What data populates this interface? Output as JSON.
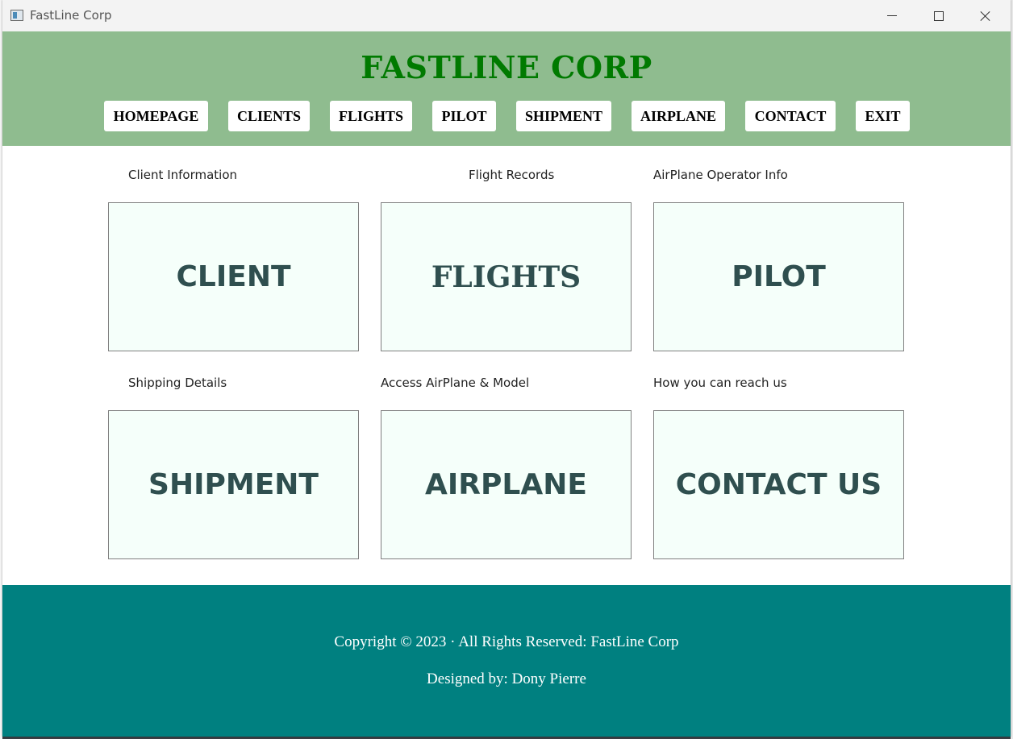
{
  "window": {
    "title": "FastLine Corp"
  },
  "header": {
    "brand": "FASTLINE CORP",
    "nav": [
      "HOMEPAGE",
      "CLIENTS",
      "FLIGHTS",
      "PILOT",
      "SHIPMENT",
      "AIRPLANE",
      "CONTACT",
      "EXIT"
    ]
  },
  "cards": [
    {
      "caption": "Client Information",
      "label": "CLIENT"
    },
    {
      "caption": "Flight Records",
      "label": "FLIGHTS"
    },
    {
      "caption": "AirPlane Operator Info",
      "label": "PILOT"
    },
    {
      "caption": "Shipping Details",
      "label": "SHIPMENT"
    },
    {
      "caption": "Access AirPlane & Model",
      "label": "AIRPLANE"
    },
    {
      "caption": "How you can reach us",
      "label": "CONTACT US"
    }
  ],
  "footer": {
    "copyright": "Copyright © 2023 · All Rights Reserved: FastLine Corp",
    "designer": "Designed by: Dony Pierre"
  },
  "colors": {
    "header_bg": "#8fbc8f",
    "brand": "#007a00",
    "card_bg": "#f5fffa",
    "card_text": "#2f4f4f",
    "footer_bg": "#008080"
  }
}
